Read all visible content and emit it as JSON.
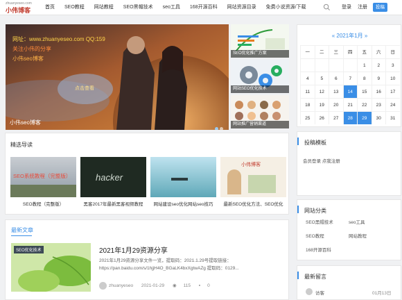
{
  "header": {
    "logo_small": "zhuanyeseo.com",
    "logo_text": "小伟博客",
    "nav": [
      "首页",
      "SEO教程",
      "网站教程",
      "SEO黑帽技术",
      "seo工具",
      "168开源百科",
      "网站资源目录",
      "免费小说资源/下载"
    ],
    "login": "登录",
    "register": "注册",
    "publish": "投稿"
  },
  "slider": {
    "line1": "网址：www.zhuanyeseo.com   QQ:159",
    "line2": "关注小伟的分享",
    "line3": "小伟seo博客",
    "button": "点击查看",
    "caption": "小伟seo博客"
  },
  "side_thumbs": [
    {
      "caption": "SEO优化推广方案"
    },
    {
      "caption": "网站SEO优化技术"
    },
    {
      "caption": "网站推广营销渠道"
    }
  ],
  "recommend": {
    "title": "精选导读",
    "items": [
      {
        "title": "SEO教程（完整版）",
        "img_text": "SEO系统教程（完整版）"
      },
      {
        "title": "黑客2017年最新黑客视频教程",
        "img_text": "hacker"
      },
      {
        "title": "网站建设seo优化网站seo技巧",
        "img_text": ""
      },
      {
        "title": "最新SEO优化方法、SEO优化",
        "img_text": "小伟博客"
      }
    ]
  },
  "latest": {
    "tab": "最新文章",
    "article": {
      "tag": "SEO优化技术",
      "title": "2021年1月29资源分享",
      "excerpt": "2021年1月29资源分享文件一览，提取码：2021.1.29号提取链接：https://pan.baidu.com/s/1hjjH4O_BGaLK4bxXgtwAZg 提取码：0129...",
      "author": "zhuanyeseo",
      "date": "2021-01-29",
      "views": "115",
      "comments": "0"
    }
  },
  "calendar": {
    "header": "« 2021年1月 »",
    "weekdays": [
      "一",
      "二",
      "三",
      "四",
      "五",
      "六",
      "日"
    ],
    "rows": [
      [
        "",
        "",
        "",
        "",
        "1",
        "2",
        "3"
      ],
      [
        "4",
        "5",
        "6",
        "7",
        "8",
        "9",
        "10"
      ],
      [
        "11",
        "12",
        "13",
        "14",
        "15",
        "16",
        "17"
      ],
      [
        "18",
        "19",
        "20",
        "21",
        "22",
        "23",
        "24"
      ],
      [
        "25",
        "26",
        "27",
        "28",
        "29",
        "30",
        "31"
      ]
    ],
    "highlight_color": "#3a8ee6"
  },
  "contribute": {
    "title": "投稿模板",
    "text": "会员登录  点我注册"
  },
  "categories": {
    "title": "网站分类",
    "items": [
      "SEO黑帽技术",
      "seo工具",
      "SEO教程",
      "网站教程",
      "168开源百科"
    ]
  },
  "recent_comments": {
    "title": "最新留言",
    "user": "访客",
    "date": "01月13日"
  }
}
